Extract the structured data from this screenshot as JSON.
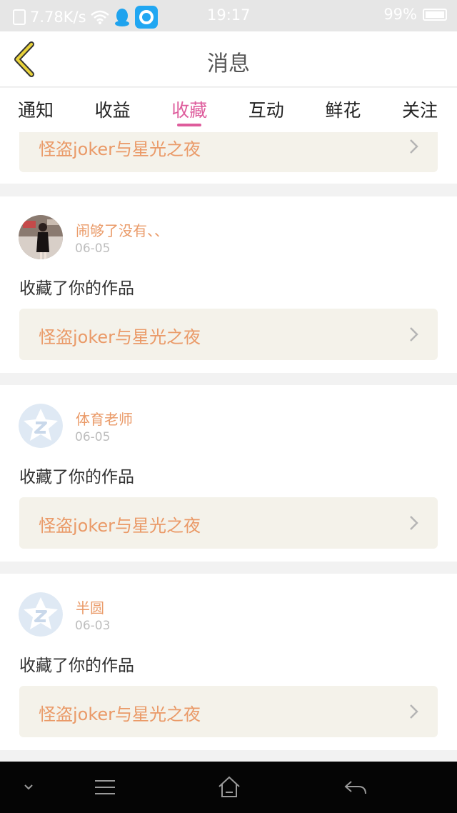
{
  "status_bar": {
    "speed": "7.78K/s",
    "time": "19:17",
    "battery": "99%"
  },
  "header": {
    "title": "消息"
  },
  "tabs": [
    {
      "label": "通知"
    },
    {
      "label": "收益"
    },
    {
      "label": "收藏"
    },
    {
      "label": "互动"
    },
    {
      "label": "鲜花"
    },
    {
      "label": "关注"
    }
  ],
  "active_tab": "收藏",
  "partial_item": {
    "work_title": "怪盗joker与星光之夜"
  },
  "messages": [
    {
      "username": "闹够了没有、、",
      "date": "06-05",
      "action": "收藏了你的作品",
      "work_title": "怪盗joker与星光之夜",
      "avatar": "photo-avatar"
    },
    {
      "username": "体育老师",
      "date": "06-05",
      "action": "收藏了你的作品",
      "work_title": "怪盗joker与星光之夜",
      "avatar": "default-star-avatar"
    },
    {
      "username": "半圆",
      "date": "06-03",
      "action": "收藏了你的作品",
      "work_title": "怪盗joker与星光之夜",
      "avatar": "default-star-avatar"
    }
  ],
  "colors": {
    "accent": "#de5c9c",
    "username": "#ea9a68",
    "work_box": "#f4f2ea",
    "back_icon": "#e8d23a"
  },
  "nav_icons": [
    "chevron-down-icon",
    "menu-icon",
    "home-icon",
    "back-arrow-icon"
  ]
}
